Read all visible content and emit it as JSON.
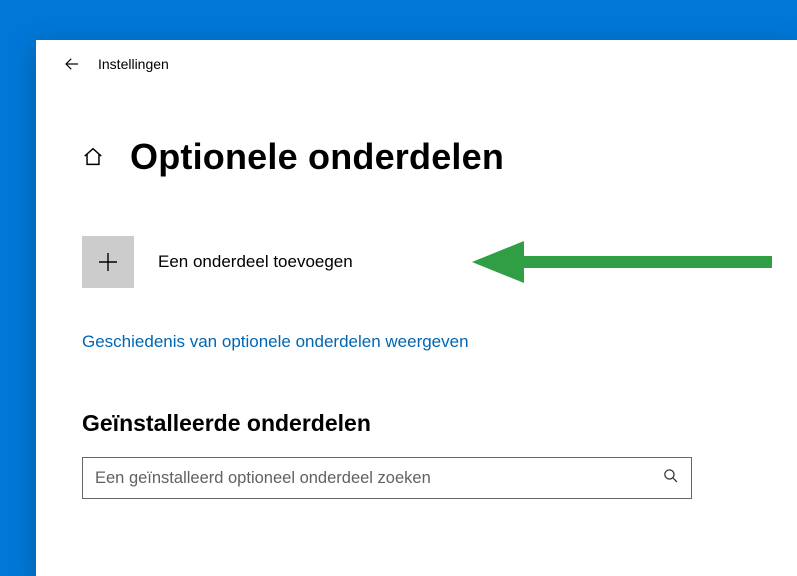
{
  "titlebar": {
    "app_title": "Instellingen"
  },
  "page": {
    "title": "Optionele onderdelen"
  },
  "add": {
    "label": "Een onderdeel toevoegen"
  },
  "history": {
    "link": "Geschiedenis van optionele onderdelen weergeven"
  },
  "installed": {
    "title": "Geïnstalleerde onderdelen",
    "search_placeholder": "Een geïnstalleerd optioneel onderdeel zoeken"
  },
  "colors": {
    "accent_blue": "#0078d7",
    "link_blue": "#0066b4",
    "tile_gray": "#cccccc",
    "arrow_green": "#2f9e44"
  }
}
